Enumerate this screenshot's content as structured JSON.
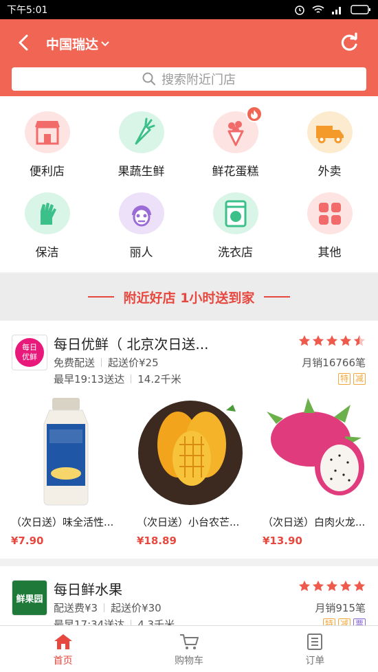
{
  "status_bar": {
    "time": "下午5:01"
  },
  "header": {
    "city": "中国瑞达",
    "search_placeholder": "搜索附近门店"
  },
  "categories": [
    {
      "label": "便利店",
      "icon": "storefront-icon",
      "color": "#f26b6b",
      "bg": "#fde3e1"
    },
    {
      "label": "果蔬生鲜",
      "icon": "carrot-icon",
      "color": "#3cc08a",
      "bg": "#d9f5e7"
    },
    {
      "label": "鲜花蛋糕",
      "icon": "flower-bouquet-icon",
      "color": "#f26b6b",
      "bg": "#fde3e1"
    },
    {
      "label": "外卖",
      "icon": "delivery-truck-icon",
      "color": "#f39a2b",
      "bg": "#fdebd0"
    },
    {
      "label": "保洁",
      "icon": "cleaning-glove-icon",
      "color": "#3cc08a",
      "bg": "#d9f5e7"
    },
    {
      "label": "丽人",
      "icon": "face-mask-icon",
      "color": "#9b6bd6",
      "bg": "#ece1f8"
    },
    {
      "label": "洗衣店",
      "icon": "washing-machine-icon",
      "color": "#3cc08a",
      "bg": "#d9f5e7"
    },
    {
      "label": "其他",
      "icon": "grid-icon",
      "color": "#f26b6b",
      "bg": "#fde3e1"
    }
  ],
  "banner": {
    "text": "附近好店 1小时送到家"
  },
  "stores": [
    {
      "logo_text": "每日\n优鲜",
      "name": "每日优鲜（ 北京次日送...",
      "delivery": "免费配送",
      "min_order": "起送价¥25",
      "eta": "最早19:13送达",
      "distance": "14.2千米",
      "rating": 4.5,
      "monthly_sales": "月销16766笔",
      "tags": [
        {
          "text": "特",
          "color": "#f3a73b"
        },
        {
          "text": "减",
          "color": "#f3a73b"
        }
      ],
      "products": [
        {
          "name": "（次日送）味全活性...",
          "price": "¥7.90",
          "image": "yogurt-bottle"
        },
        {
          "name": "（次日送）小台农芒...",
          "price": "¥18.89",
          "image": "mango"
        },
        {
          "name": "（次日送）白肉火龙...",
          "price": "¥13.90",
          "image": "dragon-fruit"
        }
      ]
    },
    {
      "logo_text": "鲜果园",
      "name": "每日鲜水果",
      "delivery": "配送费¥3",
      "min_order": "起送价¥30",
      "eta": "最早17:34送达",
      "distance": "4.3千米",
      "rating": 5,
      "monthly_sales": "月销915笔",
      "tags": [
        {
          "text": "特",
          "color": "#f3a73b"
        },
        {
          "text": "减",
          "color": "#f3a73b"
        },
        {
          "text": "票",
          "color": "#8a6ad6"
        }
      ]
    }
  ],
  "tabbar": {
    "items": [
      {
        "label": "首页",
        "icon": "home-icon",
        "active": true
      },
      {
        "label": "购物车",
        "icon": "cart-icon",
        "active": false
      },
      {
        "label": "订单",
        "icon": "order-list-icon",
        "active": false
      }
    ]
  }
}
